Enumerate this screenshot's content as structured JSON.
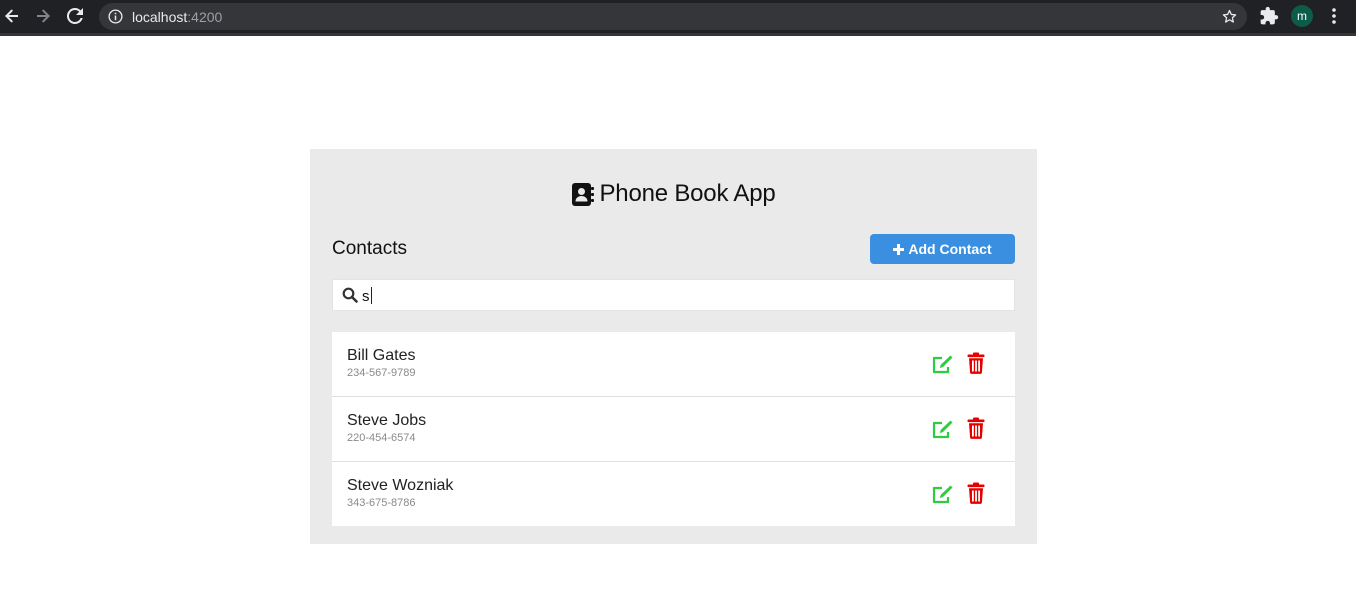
{
  "browser": {
    "url_host": "localhost",
    "url_port": ":4200",
    "profile_initial": "m"
  },
  "app": {
    "title": "Phone Book App",
    "contacts_heading": "Contacts",
    "add_button_label": "Add Contact",
    "add_button_icon": "plus-icon",
    "search": {
      "value": "s",
      "icon": "search-icon"
    },
    "colors": {
      "accent": "#3a8fe0",
      "edit": "#2ecc40",
      "delete": "#e60000",
      "card_bg": "#eaeaea"
    },
    "contacts": [
      {
        "name": "Bill Gates",
        "phone": "234-567-9789"
      },
      {
        "name": "Steve Jobs",
        "phone": "220-454-6574"
      },
      {
        "name": "Steve Wozniak",
        "phone": "343-675-8786"
      }
    ]
  }
}
